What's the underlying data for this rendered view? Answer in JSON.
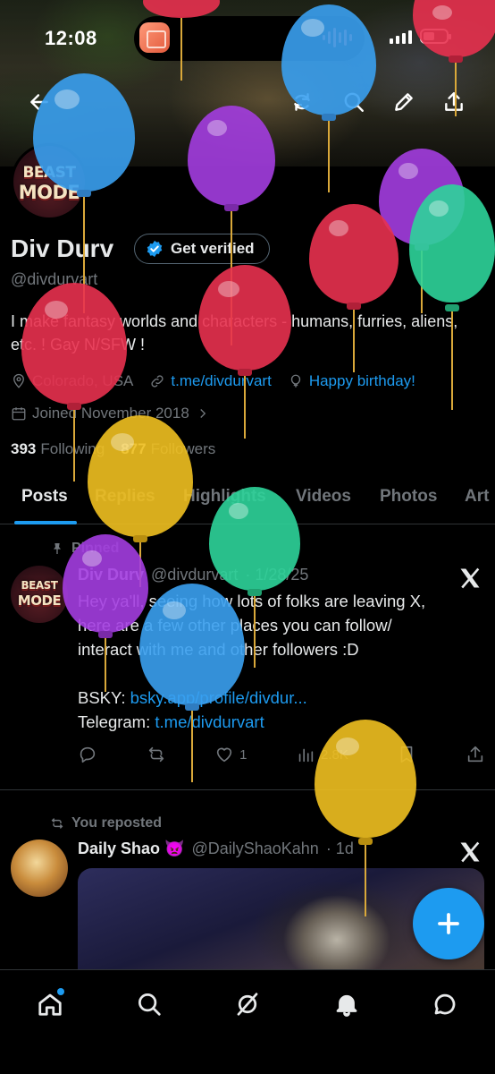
{
  "status_bar": {
    "time": "12:08"
  },
  "profile": {
    "name": "Div Durv",
    "verify_label": "Get verified",
    "handle": "@divdurvart",
    "bio": "I make fantasy worlds and characters - humans, furries, aliens, etc. ! Gay N/SFW !",
    "location": "Colorado, USA",
    "link": "t.me/divdurvart",
    "birthday": "Happy birthday!",
    "joined": "Joined November 2018",
    "following_count": "393",
    "following_label": "Following",
    "followers_count": "877",
    "followers_label": "Followers",
    "avatar_logo_top": "BEAST",
    "avatar_logo_bottom": "MODE"
  },
  "tabs": [
    {
      "label": "Posts",
      "active": true
    },
    {
      "label": "Replies"
    },
    {
      "label": "Highlights"
    },
    {
      "label": "Videos"
    },
    {
      "label": "Photos"
    },
    {
      "label": "Art"
    }
  ],
  "pinned_post": {
    "pinned_label": "Pinned",
    "author": "Div Durv",
    "handle": "@divdurvart",
    "date": "· 1/28/25",
    "text_line1": "Hey ya'll, seeing how lots of folks are leaving X,",
    "text_line2": "here are a few other places you can follow/",
    "text_line3": "interact with me and other followers :D",
    "bsky_label": "BSKY:",
    "bsky_link": "bsky.app/profile/divdur...",
    "telegram_label": "Telegram:",
    "telegram_link": "t.me/divdurvart",
    "likes": "1",
    "views": "2.8K"
  },
  "repost": {
    "repost_label": "You reposted",
    "author": "Daily Shao 👿",
    "handle": "@DailyShaoKahn",
    "time": "· 1d"
  },
  "colors": {
    "accent": "#1d9bf0",
    "background": "#000000",
    "secondary_text": "#71767b",
    "balloon_blue": "#3aa0f0",
    "balloon_purple": "#a33de0",
    "balloon_red": "#e8314f",
    "balloon_green": "#2ed49a",
    "balloon_yellow": "#f0c020"
  },
  "icons": {
    "top_nav": [
      "back-arrow-icon",
      "grok-icon",
      "search-icon",
      "edit-pencil-icon",
      "share-icon"
    ],
    "bottom_nav": [
      "home-icon",
      "search-icon",
      "grok-icon",
      "notifications-bell-icon",
      "messages-icon"
    ]
  }
}
